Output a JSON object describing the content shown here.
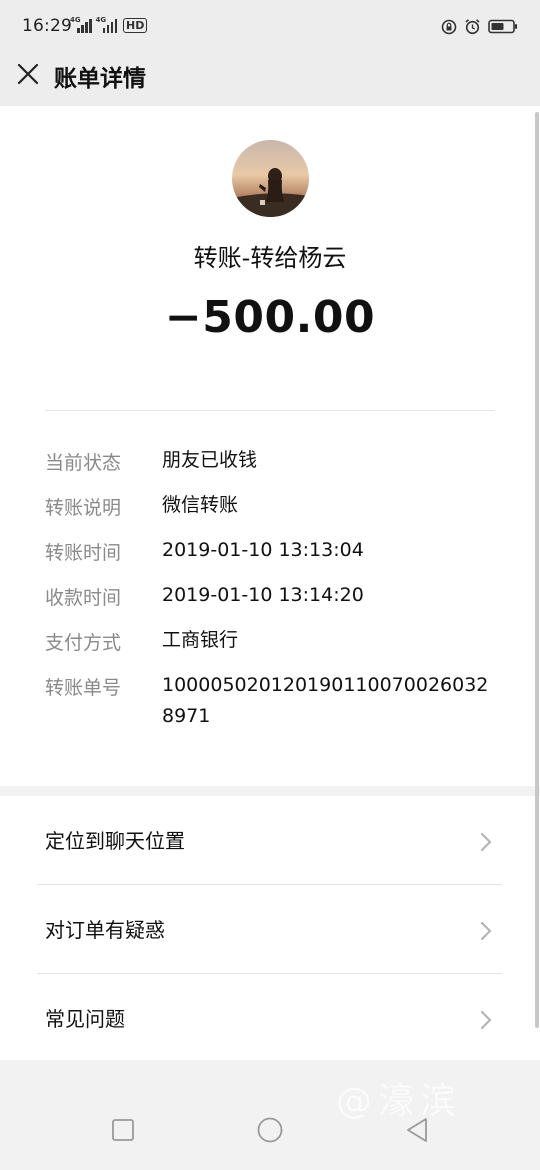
{
  "status_bar": {
    "time": "16:29",
    "signal_tags": [
      "4G",
      "4G"
    ],
    "hd_label": "HD"
  },
  "nav": {
    "title": "账单详情",
    "close_icon": "close-icon"
  },
  "detail": {
    "avatar_icon": "avatar-photo",
    "title": "转账-转给杨云",
    "amount": "−500.00",
    "rows": [
      {
        "label": "当前状态",
        "value": "朋友已收钱"
      },
      {
        "label": "转账说明",
        "value": "微信转账"
      },
      {
        "label": "转账时间",
        "value": "2019-01-10 13:13:04"
      },
      {
        "label": "收款时间",
        "value": "2019-01-10 13:14:20"
      },
      {
        "label": "支付方式",
        "value": "工商银行"
      },
      {
        "label": "转账单号",
        "value": "1000050201201901100700260328971"
      }
    ]
  },
  "actions": [
    {
      "label": "定位到聊天位置",
      "icon": "chevron-right-icon"
    },
    {
      "label": "对订单有疑惑",
      "icon": "chevron-right-icon"
    },
    {
      "label": "常见问题",
      "icon": "chevron-right-icon"
    }
  ],
  "system_nav": {
    "buttons": [
      "recents-square-icon",
      "home-circle-icon",
      "back-triangle-icon"
    ]
  },
  "watermark": "@濠滨",
  "colors": {
    "header_bg": "#ededed",
    "card_bg": "#ffffff",
    "label_gray": "#8a8a8a",
    "text_dark": "#111111"
  }
}
